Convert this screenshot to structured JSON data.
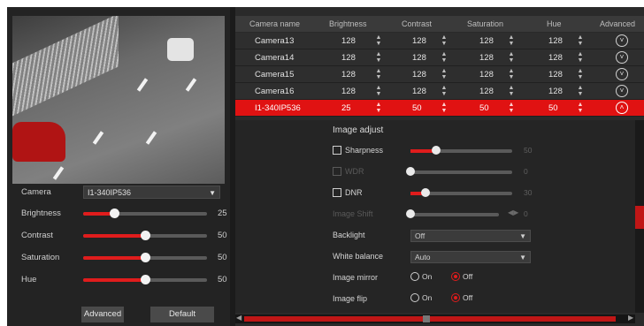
{
  "left": {
    "camera_label": "Camera",
    "camera_value": "I1-340IP536",
    "controls": [
      {
        "label": "Brightness",
        "value": "25",
        "fraction": 0.25
      },
      {
        "label": "Contrast",
        "value": "50",
        "fraction": 0.5
      },
      {
        "label": "Saturation",
        "value": "50",
        "fraction": 0.5
      },
      {
        "label": "Hue",
        "value": "50",
        "fraction": 0.5
      }
    ],
    "advanced_label": "Advanced",
    "default_label": "Default"
  },
  "table": {
    "headers": [
      "Camera name",
      "Brightness",
      "Contrast",
      "Saturation",
      "Hue",
      "Advanced"
    ],
    "rows": [
      {
        "name": "Camera13",
        "brightness": "128",
        "contrast": "128",
        "saturation": "128",
        "hue": "128"
      },
      {
        "name": "Camera14",
        "brightness": "128",
        "contrast": "128",
        "saturation": "128",
        "hue": "128"
      },
      {
        "name": "Camera15",
        "brightness": "128",
        "contrast": "128",
        "saturation": "128",
        "hue": "128"
      },
      {
        "name": "Camera16",
        "brightness": "128",
        "contrast": "128",
        "saturation": "128",
        "hue": "128"
      },
      {
        "name": "I1-340IP536",
        "brightness": "25",
        "contrast": "50",
        "saturation": "50",
        "hue": "50"
      }
    ],
    "selected_row": 4
  },
  "image_adjust": {
    "title": "Image adjust",
    "sharpness": {
      "label": "Sharpness",
      "value": "50",
      "fraction": 0.25
    },
    "wdr": {
      "label": "WDR",
      "value": "0",
      "fraction": 0.0
    },
    "dnr": {
      "label": "DNR",
      "value": "30",
      "fraction": 0.15
    },
    "image_shift": {
      "label": "Image Shift",
      "value": "0",
      "fraction": 0.0
    },
    "backlight": {
      "label": "Backlight",
      "value": "Off"
    },
    "white_balance": {
      "label": "White balance",
      "value": "Auto"
    },
    "image_mirror": {
      "label": "Image mirror",
      "on_label": "On",
      "off_label": "Off"
    },
    "image_flip": {
      "label": "Image flip",
      "on_label": "On",
      "off_label": "Off"
    }
  },
  "colors": {
    "accent": "#e01212",
    "background": "#1b1b1b"
  }
}
